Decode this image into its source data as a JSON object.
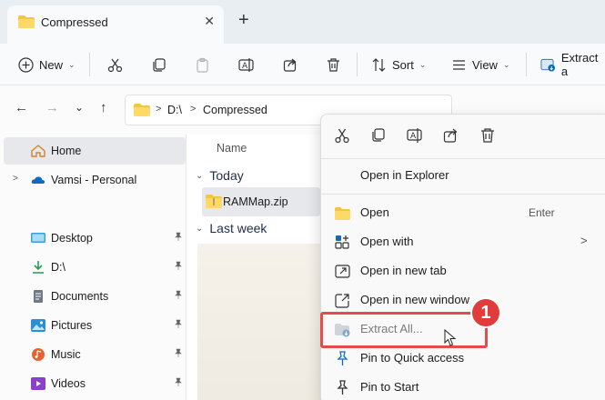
{
  "tab": {
    "title": "Compressed",
    "close_glyph": "✕",
    "new_tab_glyph": "+"
  },
  "toolbar": {
    "new_label": "New",
    "sort_label": "Sort",
    "view_label": "View",
    "extract_label": "Extract a",
    "chevron": "⌄"
  },
  "nav": {
    "back": "←",
    "forward": "→",
    "recent": "⌄",
    "up": "↑"
  },
  "address": {
    "crumb_sep": ">",
    "drive": "D:\\",
    "folder": "Compressed"
  },
  "sidebar": {
    "items": [
      {
        "label": "Home",
        "icon": "home-icon"
      },
      {
        "label": "Vamsi - Personal",
        "icon": "onedrive-icon"
      },
      {
        "label": "Desktop",
        "icon": "desktop-icon"
      },
      {
        "label": "D:\\",
        "icon": "download-icon"
      },
      {
        "label": "Documents",
        "icon": "documents-icon"
      },
      {
        "label": "Pictures",
        "icon": "pictures-icon"
      },
      {
        "label": "Music",
        "icon": "music-icon"
      },
      {
        "label": "Videos",
        "icon": "videos-icon"
      }
    ],
    "chevron": ">",
    "pin_glyph": "📌"
  },
  "main": {
    "column_name": "Name",
    "group_today": "Today",
    "group_last_week": "Last week",
    "file_name": "RAMMap.zip",
    "group_chevron": "⌄"
  },
  "context_menu": {
    "items": [
      {
        "label": "Open in Explorer",
        "icon": ""
      },
      {
        "label": "Open",
        "shortcut": "Enter",
        "icon": "folder-icon"
      },
      {
        "label": "Open with",
        "submenu": ">",
        "icon": "open-with-icon"
      },
      {
        "label": "Open in new tab",
        "icon": "new-tab-icon"
      },
      {
        "label": "Open in new window",
        "icon": "new-window-icon"
      },
      {
        "label": "Extract All...",
        "icon": "extract-icon"
      },
      {
        "label": "Pin to Quick access",
        "icon": "pin-icon"
      },
      {
        "label": "Pin to Start",
        "icon": "pin-icon"
      }
    ]
  },
  "annotation": {
    "badge_number": "1",
    "highlight_color": "#e44b4b"
  },
  "colors": {
    "accent": "#0067c0",
    "folder_yellow": "#f4c542",
    "badge_red": "#e13c3c"
  }
}
